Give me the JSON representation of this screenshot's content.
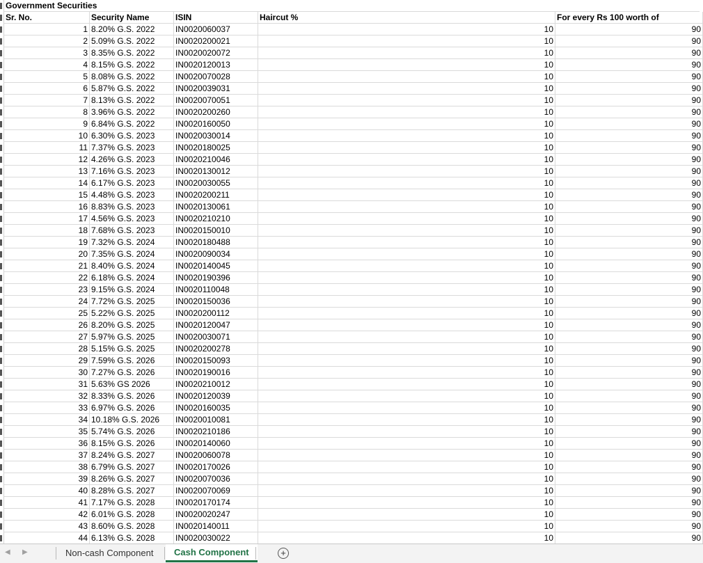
{
  "sheet": {
    "section_title": "Government Securities",
    "headers": [
      "Sr. No.",
      "Security Name",
      "ISIN",
      "Haircut %",
      "For every Rs 100 worth of"
    ],
    "rows": [
      [
        "1",
        "8.20% G.S. 2022",
        "IN0020060037",
        "10",
        "90"
      ],
      [
        "2",
        "5.09% G.S. 2022",
        "IN0020200021",
        "10",
        "90"
      ],
      [
        "3",
        "8.35% G.S. 2022",
        "IN0020020072",
        "10",
        "90"
      ],
      [
        "4",
        "8.15% G.S. 2022",
        "IN0020120013",
        "10",
        "90"
      ],
      [
        "5",
        "8.08% G.S. 2022",
        "IN0020070028",
        "10",
        "90"
      ],
      [
        "6",
        "5.87% G.S. 2022",
        "IN0020039031",
        "10",
        "90"
      ],
      [
        "7",
        "8.13% G.S. 2022",
        "IN0020070051",
        "10",
        "90"
      ],
      [
        "8",
        "3.96% G.S. 2022",
        "IN0020200260",
        "10",
        "90"
      ],
      [
        "9",
        "6.84% G.S. 2022",
        "IN0020160050",
        "10",
        "90"
      ],
      [
        "10",
        "6.30% G.S. 2023",
        "IN0020030014",
        "10",
        "90"
      ],
      [
        "11",
        "7.37% G.S. 2023",
        "IN0020180025",
        "10",
        "90"
      ],
      [
        "12",
        "4.26% G.S. 2023",
        "IN0020210046",
        "10",
        "90"
      ],
      [
        "13",
        "7.16% G.S. 2023",
        "IN0020130012",
        "10",
        "90"
      ],
      [
        "14",
        "6.17% G.S. 2023",
        "IN0020030055",
        "10",
        "90"
      ],
      [
        "15",
        "4.48% G.S. 2023",
        "IN0020200211",
        "10",
        "90"
      ],
      [
        "16",
        "8.83% G.S. 2023",
        "IN0020130061",
        "10",
        "90"
      ],
      [
        "17",
        "4.56% G.S. 2023",
        "IN0020210210",
        "10",
        "90"
      ],
      [
        "18",
        "7.68% G.S. 2023",
        "IN0020150010",
        "10",
        "90"
      ],
      [
        "19",
        "7.32% G.S. 2024",
        "IN0020180488",
        "10",
        "90"
      ],
      [
        "20",
        "7.35% G.S. 2024",
        "IN0020090034",
        "10",
        "90"
      ],
      [
        "21",
        "8.40% G.S. 2024",
        "IN0020140045",
        "10",
        "90"
      ],
      [
        "22",
        "6.18% G.S. 2024",
        "IN0020190396",
        "10",
        "90"
      ],
      [
        "23",
        "9.15% G.S. 2024",
        "IN0020110048",
        "10",
        "90"
      ],
      [
        "24",
        "7.72% G.S. 2025",
        "IN0020150036",
        "10",
        "90"
      ],
      [
        "25",
        "5.22% G.S. 2025",
        "IN0020200112",
        "10",
        "90"
      ],
      [
        "26",
        "8.20% G.S. 2025",
        "IN0020120047",
        "10",
        "90"
      ],
      [
        "27",
        "5.97% G.S. 2025",
        "IN0020030071",
        "10",
        "90"
      ],
      [
        "28",
        "5.15% G.S. 2025",
        "IN0020200278",
        "10",
        "90"
      ],
      [
        "29",
        "7.59% G.S. 2026",
        "IN0020150093",
        "10",
        "90"
      ],
      [
        "30",
        "7.27% G.S. 2026",
        "IN0020190016",
        "10",
        "90"
      ],
      [
        "31",
        "5.63% GS 2026",
        "IN0020210012",
        "10",
        "90"
      ],
      [
        "32",
        "8.33% G.S. 2026",
        "IN0020120039",
        "10",
        "90"
      ],
      [
        "33",
        "6.97% G.S. 2026",
        "IN0020160035",
        "10",
        "90"
      ],
      [
        "34",
        "10.18% G.S. 2026",
        "IN0020010081",
        "10",
        "90"
      ],
      [
        "35",
        "5.74% G.S. 2026",
        "IN0020210186",
        "10",
        "90"
      ],
      [
        "36",
        "8.15% G.S. 2026",
        "IN0020140060",
        "10",
        "90"
      ],
      [
        "37",
        "8.24% G.S. 2027",
        "IN0020060078",
        "10",
        "90"
      ],
      [
        "38",
        "6.79% G.S. 2027",
        "IN0020170026",
        "10",
        "90"
      ],
      [
        "39",
        "8.26% G.S. 2027",
        "IN0020070036",
        "10",
        "90"
      ],
      [
        "40",
        "8.28% G.S. 2027",
        "IN0020070069",
        "10",
        "90"
      ],
      [
        "41",
        "7.17% G.S. 2028",
        "IN0020170174",
        "10",
        "90"
      ],
      [
        "42",
        "6.01% G.S. 2028",
        "IN0020020247",
        "10",
        "90"
      ],
      [
        "43",
        "8.60% G.S. 2028",
        "IN0020140011",
        "10",
        "90"
      ],
      [
        "44",
        "6.13% G.S. 2028",
        "IN0020030022",
        "10",
        "90"
      ]
    ]
  },
  "tabs": {
    "items": [
      "Non-cash Component",
      "Cash Component"
    ],
    "active_index": 1,
    "add_symbol": "+",
    "prev_symbol": "◀",
    "next_symbol": "▶"
  },
  "colors": {
    "active_tab": "#217346",
    "gridline": "#dadada"
  }
}
